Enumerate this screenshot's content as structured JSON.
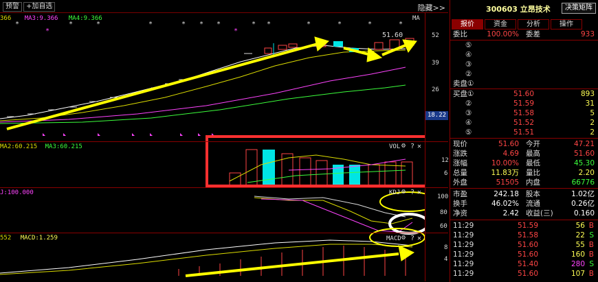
{
  "toolbar": {
    "alert": "预警",
    "add_watch": "+加自选",
    "hide_link": "隐藏>>"
  },
  "kline_panel": {
    "ma_labels": [
      {
        "text": "366",
        "color": "#dddd00"
      },
      {
        "text": "MA3:9.366",
        "color": "#ff44ff"
      },
      {
        "text": "MA4:9.366",
        "color": "#3cff3c"
      }
    ],
    "ma_right": "MA",
    "price_tag": "51.60",
    "axis": [
      "52",
      "39",
      "26"
    ],
    "current_box": "18.22"
  },
  "vol_panel": {
    "labels": [
      {
        "text": "MA2:60.215",
        "color": "#dddd00"
      },
      {
        "text": "MA3:60.215",
        "color": "#3cff3c"
      }
    ],
    "name": "VOL",
    "axis": [
      "12",
      "6"
    ]
  },
  "kdj_panel": {
    "label": {
      "text": "J:100.000",
      "color": "#ff44ff"
    },
    "name": "KDJ",
    "axis": [
      "100",
      "80",
      "60"
    ]
  },
  "macd_panel": {
    "labels": [
      {
        "text": "552",
        "color": "#dddd00"
      },
      {
        "text": "MACD:1.259",
        "color": "#ffff55"
      }
    ],
    "name": "MACD",
    "axis": [
      "8",
      "4"
    ]
  },
  "stock": {
    "title": "300603 立昂技术",
    "decision": "决策矩阵"
  },
  "tabs": [
    "报价",
    "资金",
    "分析",
    "操作"
  ],
  "commit": {
    "ratio_label": "委比",
    "ratio": "100.00%",
    "diff_label": "委差",
    "diff": "933"
  },
  "sell_orders": [
    {
      "num": "⑤"
    },
    {
      "num": "④"
    },
    {
      "num": "③"
    },
    {
      "num": "②"
    },
    {
      "num": "卖盘①"
    }
  ],
  "buy_orders": [
    {
      "num": "买盘①",
      "price": "51.60",
      "vol": "893"
    },
    {
      "num": "②",
      "price": "51.59",
      "vol": "31"
    },
    {
      "num": "③",
      "price": "51.58",
      "vol": "5"
    },
    {
      "num": "④",
      "price": "51.52",
      "vol": "2"
    },
    {
      "num": "⑤",
      "price": "51.51",
      "vol": "2"
    }
  ],
  "quote": [
    {
      "l1": "现价",
      "v1": "51.60",
      "c1": "red",
      "l2": "今开",
      "v2": "47.21",
      "c2": "red"
    },
    {
      "l1": "涨跌",
      "v1": "4.69",
      "c1": "red",
      "l2": "最高",
      "v2": "51.60",
      "c2": "red"
    },
    {
      "l1": "涨幅",
      "v1": "10.00%",
      "c1": "red",
      "l2": "最低",
      "v2": "45.30",
      "c2": "green"
    },
    {
      "l1": "总量",
      "v1": "11.83万",
      "c1": "yellow",
      "l2": "量比",
      "v2": "2.20",
      "c2": "yellow"
    },
    {
      "l1": "外盘",
      "v1": "51505",
      "c1": "red",
      "l2": "内盘",
      "v2": "66776",
      "c2": "green"
    }
  ],
  "fundamental": [
    {
      "l1": "市盈",
      "v1": "242.18",
      "c1": "white",
      "l2": "股本",
      "v2": "1.02亿",
      "c2": "white"
    },
    {
      "l1": "换手",
      "v1": "46.02%",
      "c1": "white",
      "l2": "流通",
      "v2": "0.26亿",
      "c2": "white"
    },
    {
      "l1": "净资",
      "v1": "2.42",
      "c1": "white",
      "l2": "收益(三)",
      "v2": "0.160",
      "c2": "white"
    }
  ],
  "trades": [
    {
      "t": "11:29",
      "p": "51.59",
      "q": "56",
      "qc": "yellow",
      "bs": "B",
      "bsc": "red"
    },
    {
      "t": "11:29",
      "p": "51.58",
      "q": "22",
      "qc": "yellow",
      "bs": "S",
      "bsc": "green"
    },
    {
      "t": "11:29",
      "p": "51.60",
      "q": "55",
      "qc": "yellow",
      "bs": "B",
      "bsc": "red"
    },
    {
      "t": "11:29",
      "p": "51.60",
      "q": "160",
      "qc": "yellow",
      "bs": "B",
      "bsc": "red"
    },
    {
      "t": "11:29",
      "p": "51.40",
      "q": "280",
      "qc": "magenta",
      "bs": "S",
      "bsc": "green"
    },
    {
      "t": "11:29",
      "p": "51.60",
      "q": "107",
      "qc": "yellow",
      "bs": "B",
      "bsc": "red"
    }
  ]
}
